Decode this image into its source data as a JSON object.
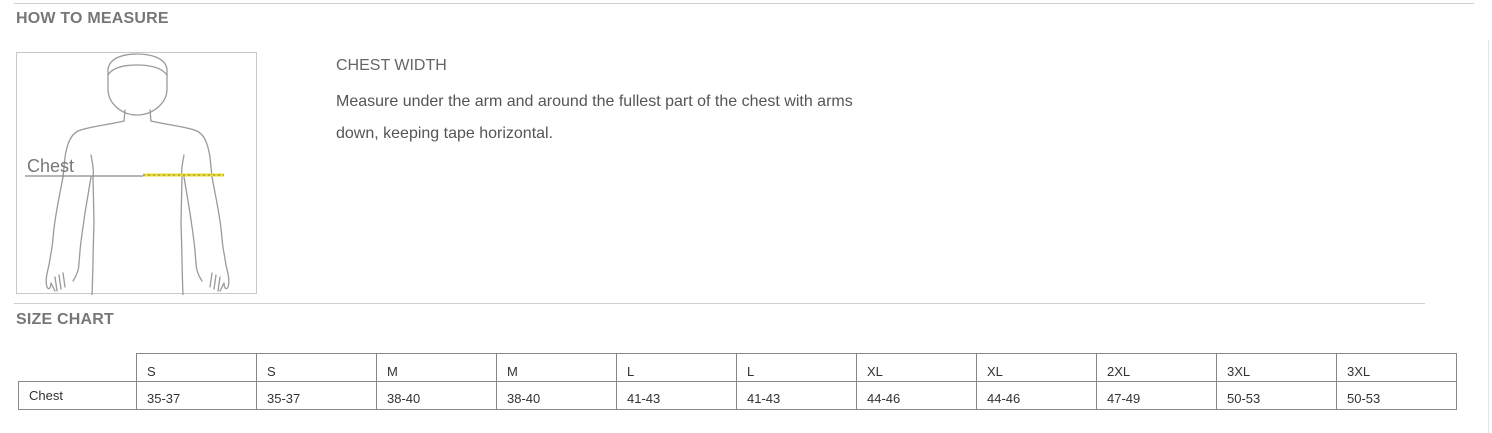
{
  "how_to_measure": {
    "heading": "HOW TO MEASURE",
    "figure_label": "Chest",
    "measure_title": "CHEST WIDTH",
    "measure_text": "Measure under the arm and around the fullest part of the chest with arms down, keeping tape horizontal."
  },
  "size_chart": {
    "heading": "SIZE CHART",
    "sizes": [
      "S",
      "S",
      "M",
      "M",
      "L",
      "L",
      "XL",
      "XL",
      "2XL",
      "3XL",
      "3XL"
    ],
    "rows": [
      {
        "label": "Chest",
        "values": [
          "35-37",
          "35-37",
          "38-40",
          "38-40",
          "41-43",
          "41-43",
          "44-46",
          "44-46",
          "47-49",
          "50-53",
          "50-53"
        ]
      }
    ]
  },
  "colors": {
    "tape": "#e8d832",
    "border": "#888888",
    "heading": "#777777"
  }
}
